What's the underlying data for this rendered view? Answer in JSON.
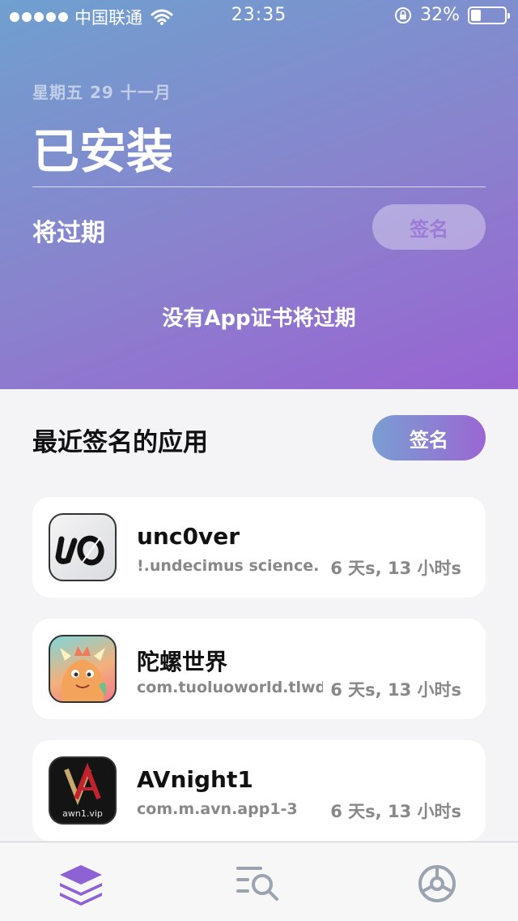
{
  "status": {
    "carrier": "中国联通",
    "time": "23:35",
    "battery": "32%",
    "battery_level": 0.32
  },
  "header": {
    "date": "星期五 29 十一月",
    "title": "已安装",
    "expiring_label": "将过期",
    "sign_button": "签名",
    "empty_message": "没有App证书将过期"
  },
  "recent": {
    "label": "最近签名的应用",
    "sign_button": "签名",
    "apps": [
      {
        "name": "unc0ver",
        "bundle": "!.undecimus   science.",
        "expires": "6 天s, 13 小时s",
        "icon": "unc0ver-icon"
      },
      {
        "name": "陀螺世界",
        "bundle": "com.tuoluoworld.tlwd",
        "expires": "6 天s, 13 小时s",
        "icon": "dinosaur-icon"
      },
      {
        "name": "AVnight1",
        "bundle": "com.m.avn.app1-3",
        "expires": "6 天s, 13 小时s",
        "icon": "avnight-icon",
        "icon_text": "awn1.vip"
      }
    ]
  },
  "tabbar": {
    "tabs": [
      "layers-icon",
      "search-list-icon",
      "gear-icon"
    ],
    "active_color": "#8e62d4",
    "inactive_color": "#9aa3b0"
  }
}
